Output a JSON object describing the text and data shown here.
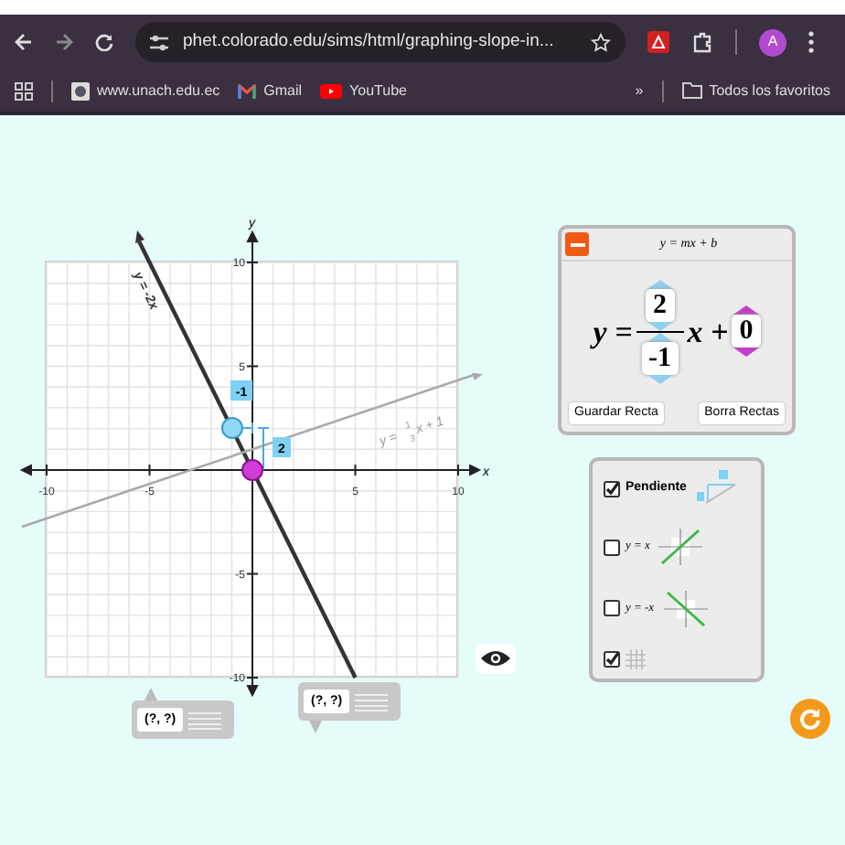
{
  "browser": {
    "url": "phet.colorado.edu/sims/html/graphing-slope-in...",
    "profile_initial": "A",
    "bookmarks": [
      {
        "kind": "site",
        "label": "www.unach.edu.ec"
      },
      {
        "kind": "gmail",
        "label": "Gmail"
      },
      {
        "kind": "youtube",
        "label": "YouTube"
      }
    ],
    "more": "»",
    "all_bookmarks": "Todos los favoritos"
  },
  "graph": {
    "x_axis_label": "x",
    "y_axis_label": "y",
    "x_ticks": [
      "-10",
      "-5",
      "5",
      "10"
    ],
    "y_ticks": [
      "10",
      "5",
      "-5",
      "-10"
    ],
    "lines": [
      {
        "kind": "current",
        "label": "y = -2x"
      },
      {
        "kind": "saved",
        "prefix": "y =",
        "numerator": "1",
        "denominator": "3",
        "suffix": "x + 1"
      }
    ],
    "slope_run": "-1",
    "slope_rise": "2"
  },
  "equation": {
    "title": "y = mx + b",
    "lhs": "y =",
    "rise": "2",
    "run": "-1",
    "x_term": "x +",
    "intercept": "0",
    "buttons": [
      "Guardar Recta",
      "Borra Rectas"
    ]
  },
  "options": [
    {
      "kind": "slope",
      "label": "Pendiente",
      "checked": true
    },
    {
      "kind": "identity",
      "label": "y = x",
      "checked": false
    },
    {
      "kind": "negative",
      "label": "y = -x",
      "checked": false
    },
    {
      "kind": "grid",
      "checked": true
    }
  ],
  "point_tools": [
    {
      "value": "(?, ?)"
    },
    {
      "value": "(?, ?)"
    }
  ]
}
